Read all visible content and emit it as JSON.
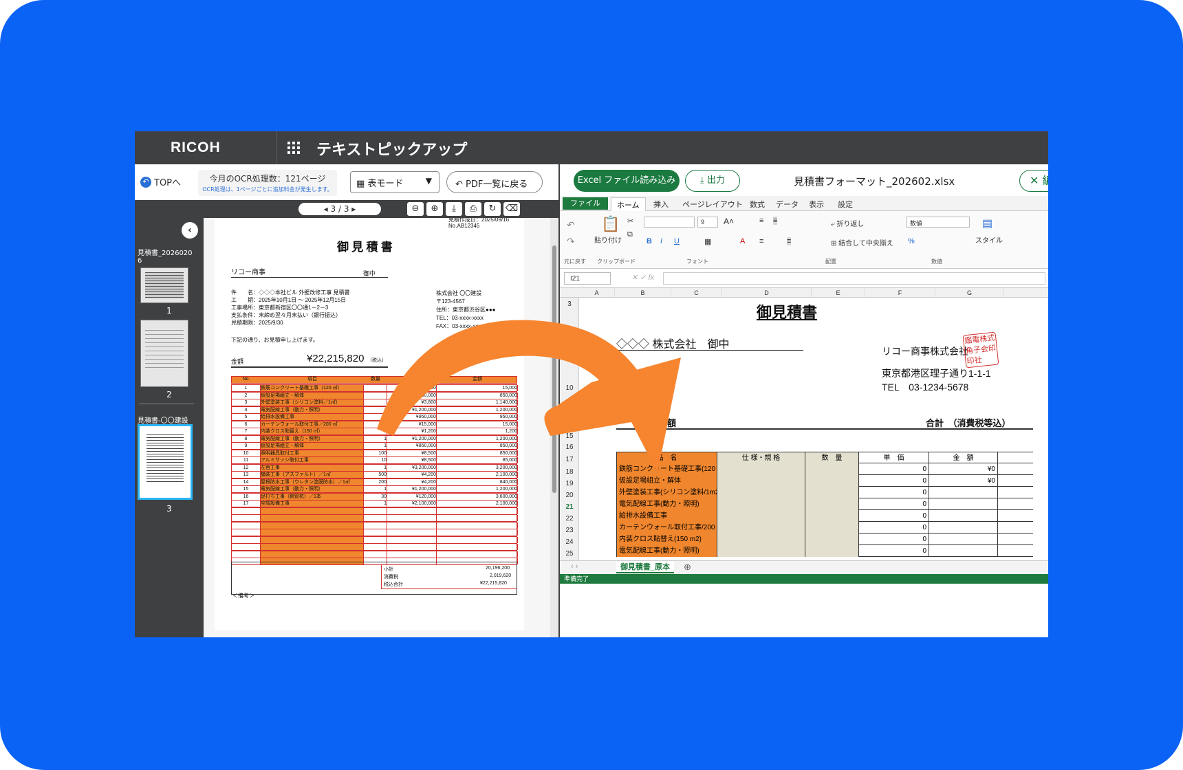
{
  "app": {
    "brand": "RICOH",
    "title": "テキストピックアップ"
  },
  "left": {
    "top_link": "TOPへ",
    "ocr_count": "今月のOCR処理数：121ページ",
    "ocr_note": "OCR処理は、1ページごとに追加料金が発生します。",
    "mode": "表モード",
    "pdf_back": "PDF一覧に戻る",
    "pager": "3 / 3",
    "files": [
      {
        "name": "見積書_20260206",
        "pages": [
          "1",
          "2"
        ]
      },
      {
        "name": "見積書-〇〇建設",
        "pages": [
          "3"
        ]
      }
    ]
  },
  "doc": {
    "date_line": "見積作成日：2025/09/16",
    "no": "No.AB12345",
    "title": "御 見 積 書",
    "client": "リコー商事",
    "honorific": "御中",
    "fields": [
      {
        "label": "件　　名：",
        "value": "◇◇◇本社ビル 外壁改修工事 見積書"
      },
      {
        "label": "工　　期：",
        "value": "2025年10月1日 〜 2025年12月15日"
      },
      {
        "label": "工事場所：",
        "value": "東京都新宿区〇〇通1－2－3"
      },
      {
        "label": "支払条件：",
        "value": "末締め翌々月末払い（銀行振込）"
      },
      {
        "label": "見積期限：",
        "value": "2025/9/30"
      }
    ],
    "company": [
      "株式会社 〇〇建設",
      "〒123-4567",
      "住所：東京都渋谷区●●●",
      "TEL：03-xxxx-xxxx",
      "FAX：03-xxxx-xxxx"
    ],
    "intro": "下記の通り、お見積申し上げます。",
    "amount_label": "金額",
    "amount": "¥22,215,820",
    "tax_note": "（税込）",
    "headers": [
      "No.",
      "項目",
      "数量",
      "単価",
      "金額"
    ],
    "rows": [
      [
        "1",
        "鉄筋コンクリート基礎工事（120 ㎡）",
        "",
        "¥15,000",
        "15,000"
      ],
      [
        "2",
        "仮設足場組立・解体",
        "",
        "¥850,000",
        "850,000"
      ],
      [
        "3",
        "外壁塗装工事（シリコン塗料／1㎡）",
        "",
        "¥3,800",
        "1,140,000"
      ],
      [
        "4",
        "電気配線工事（動力・照明）",
        "",
        "¥1,200,000",
        "1,200,000"
      ],
      [
        "5",
        "給排水設備工事",
        "",
        "¥950,000",
        "950,000"
      ],
      [
        "6",
        "カーテンウォール取付工事／200 ㎡",
        "1",
        "¥15,000",
        "15,000"
      ],
      [
        "7",
        "内装クロス貼替え（150 ㎡）",
        "1",
        "¥1,200",
        "1,200"
      ],
      [
        "8",
        "電気配線工事（動力・照明）",
        "1",
        "¥1,200,000",
        "1,200,000"
      ],
      [
        "9",
        "仮設足場組立・解体",
        "1",
        "¥850,000",
        "850,000"
      ],
      [
        "10",
        "照明器具取付工事",
        "100",
        "¥8,500",
        "850,000"
      ],
      [
        "11",
        "アルミサッシ取付工事",
        "10",
        "¥8,500",
        "85,000"
      ],
      [
        "12",
        "左官工事",
        "1",
        "¥3,200,000",
        "3,200,000"
      ],
      [
        "13",
        "舗装工事（アスファルト）／1㎡",
        "500",
        "¥4,200",
        "2,100,000"
      ],
      [
        "14",
        "屋根防水工事（ウレタン塗膜防水）／1㎡",
        "200",
        "¥4,200",
        "840,000"
      ],
      [
        "15",
        "電気配線工事（動力・照明）",
        "1",
        "¥1,200,000",
        "1,200,000"
      ],
      [
        "16",
        "足打ち工事（鋼管杭）／1本",
        "30",
        "¥120,000",
        "3,600,000"
      ],
      [
        "17",
        "空調設備工事",
        "1",
        "¥2,100,000",
        "2,100,000"
      ]
    ],
    "subtotal_label": "小計",
    "subtotal": "20,196,200",
    "tax_label": "消費税",
    "tax": "2,019,620",
    "total_label": "税込合計",
    "total": "¥22,215,820",
    "remarks": "＜備考＞"
  },
  "right": {
    "load_btn": "Excel ファイル読み込み",
    "out_btn": "出力",
    "file": "見積書フォーマット_202602.xlsx",
    "edit_btn": "編",
    "tabs": [
      "ファイル",
      "ホーム",
      "挿入",
      "ページレイアウト",
      "数式",
      "データ",
      "表示",
      "設定"
    ],
    "ribbon": {
      "undo": "元に戻す",
      "clipboard": "クリップボード",
      "paste": "貼り付け",
      "font_group": "フォント",
      "font_size": "9",
      "wrap": "折り返し",
      "merge": "結合して中央揃え",
      "align_group": "配置",
      "numfmt": "数値",
      "num_group": "数値",
      "style": "スタイル"
    },
    "cell_ref": "I21",
    "columns": [
      "A",
      "B",
      "C",
      "D",
      "E",
      "F",
      "G"
    ],
    "row_nums": [
      "3",
      "10",
      "14",
      "15",
      "16",
      "17",
      "18",
      "19",
      "20",
      "21",
      "22",
      "23",
      "24",
      "25"
    ],
    "sheet": {
      "title": "御見積書",
      "client": "◇◇◇ 株式会社　御中",
      "company": "リコー商事株式会社",
      "address": "東京都港区理子通り1-1-1",
      "tel": "TEL　03-1234-5678",
      "seal": "鑑電株式角子会印印社",
      "amount_tail": "額",
      "total_label": "合計　（消費税等込）",
      "headers": [
        "品　名",
        "仕 様・規 格",
        "数　量",
        "単　価",
        "金　額"
      ],
      "rows": [
        [
          "鉄筋コンクリート基礎工事(120 m2)",
          "",
          "",
          "0",
          "¥0"
        ],
        [
          "仮設足場組立・解体",
          "",
          "",
          "0",
          "¥0"
        ],
        [
          "外壁塗装工事(シリコン塗料/1m2)",
          "",
          "",
          "0",
          ""
        ],
        [
          "電気配線工事(動力・照明)",
          "",
          "",
          "0",
          ""
        ],
        [
          "給排水設備工事",
          "",
          "",
          "0",
          ""
        ],
        [
          "カーテンウォール取付工事/200 m2",
          "",
          "",
          "0",
          ""
        ],
        [
          "内装クロス貼替え(150 m2)",
          "",
          "",
          "0",
          ""
        ],
        [
          "電気配線工事(動力・照明)",
          "",
          "",
          "0",
          ""
        ]
      ]
    },
    "sheet_tab": "御見積書_原本",
    "status": "準備完了"
  },
  "colors": {
    "background": "#0b63f5",
    "header": "#3f4042",
    "excel_green": "#1e7a3e",
    "arrow": "#f7852f",
    "cell_orange": "#f0862d",
    "table_red": "#d32f2f"
  }
}
